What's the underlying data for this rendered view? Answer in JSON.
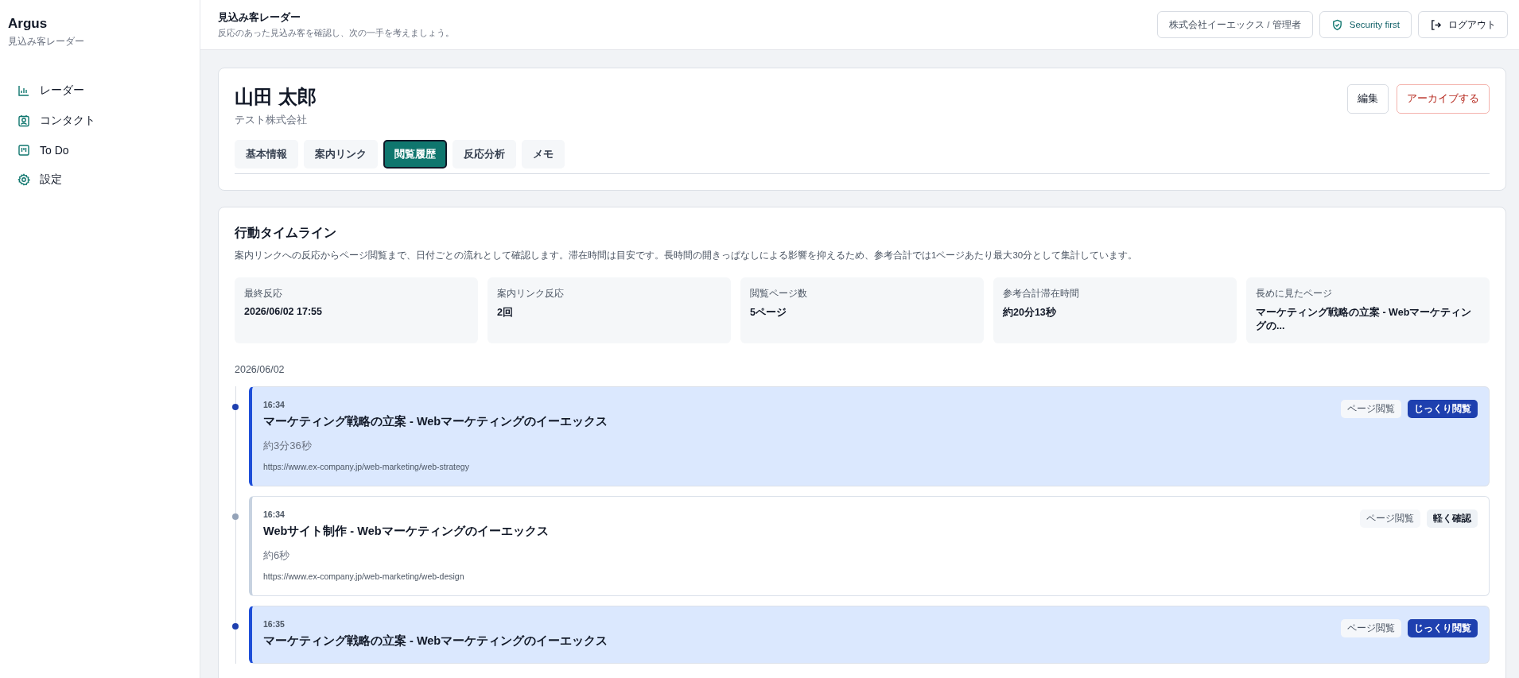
{
  "sidebar": {
    "app_name": "Argus",
    "app_subtitle": "見込み客レーダー",
    "items": [
      {
        "label": "レーダー",
        "selected": false
      },
      {
        "label": "コンタクト",
        "selected": false
      },
      {
        "label": "To Do",
        "selected": false
      },
      {
        "label": "設定",
        "selected": false
      }
    ]
  },
  "header": {
    "title": "見込み客レーダー",
    "subtitle": "反応のあった見込み客を確認し、次の一手を考えましょう。",
    "account": "株式会社イーエックス / 管理者",
    "security": "Security first",
    "logout": "ログアウト"
  },
  "profile": {
    "name": "山田 太郎",
    "company": "テスト株式会社",
    "edit": "編集",
    "archive": "アーカイブする",
    "tabs": [
      {
        "label": "基本情報",
        "selected": false
      },
      {
        "label": "案内リンク",
        "selected": false
      },
      {
        "label": "閲覧履歴",
        "selected": true
      },
      {
        "label": "反応分析",
        "selected": false
      },
      {
        "label": "メモ",
        "selected": false
      }
    ]
  },
  "timeline": {
    "title": "行動タイムライン",
    "description": "案内リンクへの反応からページ閲覧まで、日付ごとの流れとして確認します。滞在時間は目安です。長時間の開きっぱなしによる影響を抑えるため、参考合計では1ページあたり最大30分として集計しています。",
    "stats": [
      {
        "label": "最終反応",
        "value": "2026/06/02 17:55"
      },
      {
        "label": "案内リンク反応",
        "value": "2回"
      },
      {
        "label": "閲覧ページ数",
        "value": "5ページ"
      },
      {
        "label": "参考合計滞在時間",
        "value": "約20分13秒"
      },
      {
        "label": "長めに見たページ",
        "value": "マーケティング戦略の立案 - Webマーケティングの..."
      }
    ],
    "date": "2026/06/02",
    "events": [
      {
        "kind": "deep",
        "time": "16:34",
        "title": "マーケティング戦略の立案 - Webマーケティングのイーエックス",
        "duration": "約3分36秒",
        "url": "https://www.ex-company.jp/web-marketing/web-strategy",
        "tags": [
          "ページ閲覧",
          "じっくり閲覧"
        ]
      },
      {
        "kind": "light",
        "time": "16:34",
        "title": "Webサイト制作 - Webマーケティングのイーエックス",
        "duration": "約6秒",
        "url": "https://www.ex-company.jp/web-marketing/web-design",
        "tags": [
          "ページ閲覧",
          "軽く確認"
        ]
      },
      {
        "kind": "deep",
        "time": "16:35",
        "title": "マーケティング戦略の立案 - Webマーケティングのイーエックス",
        "tags": [
          "ページ閲覧",
          "じっくり閲覧"
        ]
      }
    ]
  }
}
